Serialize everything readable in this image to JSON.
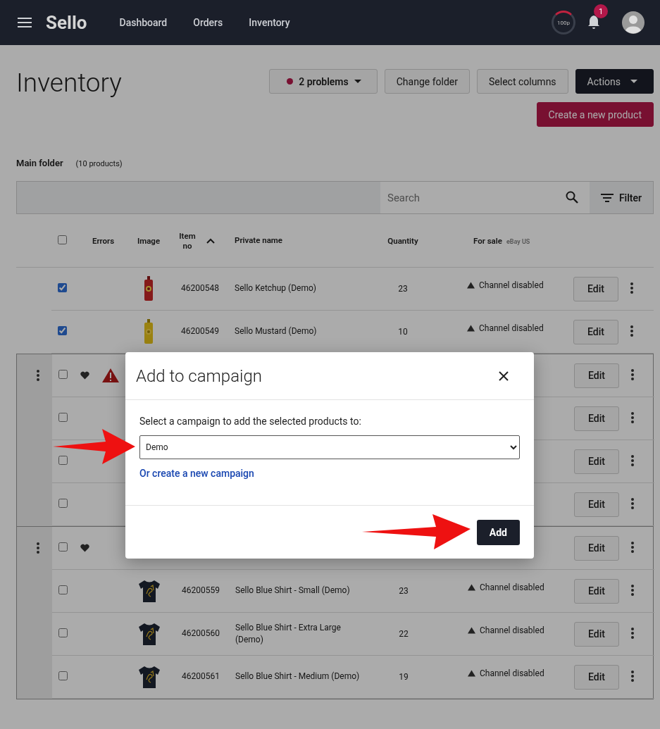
{
  "navbar": {
    "brand": "Sello",
    "links": [
      "Dashboard",
      "Orders",
      "Inventory"
    ],
    "meter": "100p",
    "notifications": "1"
  },
  "header": {
    "title": "Inventory",
    "problems": "2 problems",
    "buttons": [
      "Change folder",
      "Select columns"
    ],
    "actions": "Actions",
    "create": "Create a new product"
  },
  "folder": {
    "name": "Main folder",
    "count": "(10 products)"
  },
  "toolbar": {
    "search": {
      "placeholder": "Search"
    },
    "filter": "Filter"
  },
  "table": {
    "columns": {
      "select_all": false,
      "errors": "Errors",
      "image": "Image",
      "item_no": "Item no",
      "private_name": "Private name",
      "quantity": "Quantity",
      "for_sale": "For sale",
      "for_sale_channel": "eBay US"
    },
    "sections": [
      {
        "kind": "plain",
        "rows": [
          {
            "checked": true,
            "heart": false,
            "error": false,
            "kind": "ketchup",
            "item_no": "46200548",
            "name": "Sello Ketchup (Demo)",
            "quantity": "23",
            "status": "Channel disabled",
            "edit": "Edit"
          },
          {
            "checked": true,
            "heart": false,
            "error": false,
            "kind": "mustard",
            "item_no": "46200549",
            "name": "Sello Mustard (Demo)",
            "quantity": "10",
            "status": "Channel disabled",
            "edit": "Edit"
          }
        ]
      },
      {
        "kind": "group",
        "rows": [
          {
            "checked": false,
            "heart": true,
            "error": true,
            "edit": "Edit"
          },
          {
            "checked": false,
            "heart": false,
            "error": false,
            "edit": "Edit"
          },
          {
            "checked": false,
            "heart": false,
            "error": false,
            "edit": "Edit"
          },
          {
            "checked": false,
            "heart": false,
            "error": false,
            "edit": "Edit"
          }
        ]
      },
      {
        "kind": "group",
        "rows": [
          {
            "checked": false,
            "heart": true,
            "error": false,
            "edit": "Edit"
          },
          {
            "checked": false,
            "heart": false,
            "error": false,
            "kind": "shirt",
            "item_no": "46200559",
            "name": "Sello Blue Shirt - Small (Demo)",
            "quantity": "23",
            "status": "Channel disabled",
            "edit": "Edit"
          },
          {
            "checked": false,
            "heart": false,
            "error": false,
            "kind": "shirt",
            "item_no": "46200560",
            "name": "Sello Blue Shirt - Extra Large (Demo)",
            "quantity": "22",
            "status": "Channel disabled",
            "edit": "Edit"
          },
          {
            "checked": false,
            "heart": false,
            "error": false,
            "kind": "shirt",
            "item_no": "46200561",
            "name": "Sello Blue Shirt - Medium (Demo)",
            "quantity": "19",
            "status": "Channel disabled",
            "edit": "Edit"
          }
        ]
      }
    ]
  },
  "modal": {
    "title": "Add to campaign",
    "label": "Select a campaign to add the selected products to:",
    "campaign": "Demo",
    "link": "Or create a new campaign",
    "submit": "Add"
  }
}
